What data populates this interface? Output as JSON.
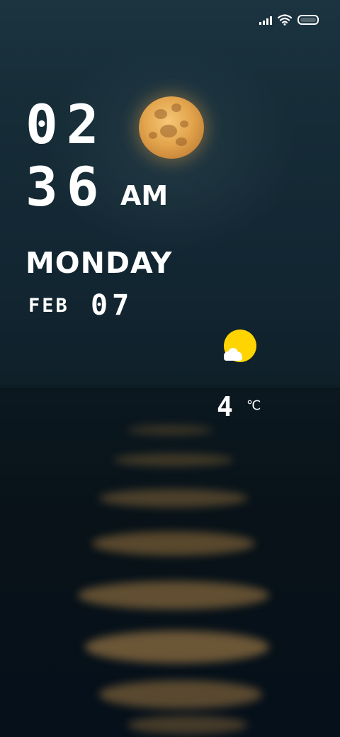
{
  "status_bar": {
    "icons": [
      "signal-icon",
      "wifi-icon",
      "battery-icon"
    ]
  },
  "clock": {
    "hour": "02",
    "minute": "36",
    "ampm": "AM"
  },
  "date": {
    "weekday": "MONDAY",
    "month": "FEB",
    "day": "07"
  },
  "weather": {
    "icon": "sun-cloud-icon",
    "temperature": "4",
    "unit": "℃",
    "colors": {
      "sun": "#ffd400",
      "cloud": "#ffffff"
    }
  },
  "wallpaper": {
    "icon": "moon-over-sea-wallpaper",
    "colors": {
      "sky": "#152b36",
      "sea": "#081218",
      "moon": "#e3a54d"
    }
  }
}
